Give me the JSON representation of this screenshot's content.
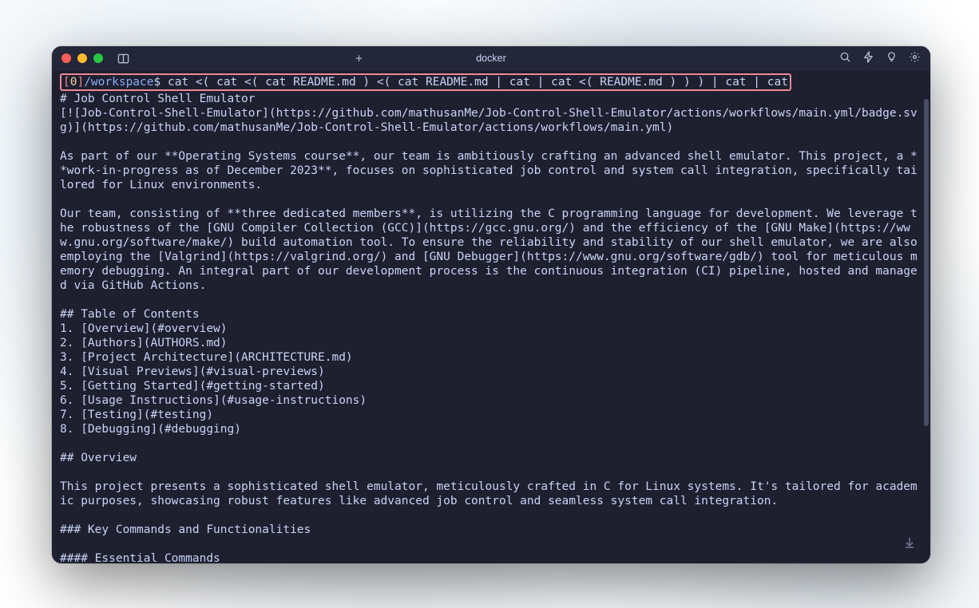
{
  "titlebar": {
    "tab_title": "docker",
    "new_tab_glyph": "+"
  },
  "prompt": {
    "open_bracket": "[",
    "job_num": "0",
    "close_bracket": "]",
    "path": "/workspace",
    "dollar": "$",
    "command": " cat <( cat <( cat README.md ) <( cat README.md | cat | cat <( README.md ) ) ) | cat | cat"
  },
  "output_lines": [
    "# Job Control Shell Emulator",
    "[![Job-Control-Shell-Emulator](https://github.com/mathusanMe/Job-Control-Shell-Emulator/actions/workflows/main.yml/badge.svg)](https://github.com/mathusanMe/Job-Control-Shell-Emulator/actions/workflows/main.yml)",
    "",
    "As part of our **Operating Systems course**, our team is ambitiously crafting an advanced shell emulator. This project, a **work-in-progress as of December 2023**, focuses on sophisticated job control and system call integration, specifically tailored for Linux environments.",
    "",
    "Our team, consisting of **three dedicated members**, is utilizing the C programming language for development. We leverage the robustness of the [GNU Compiler Collection (GCC)](https://gcc.gnu.org/) and the efficiency of the [GNU Make](https://www.gnu.org/software/make/) build automation tool. To ensure the reliability and stability of our shell emulator, we are also employing the [Valgrind](https://valgrind.org/) and [GNU Debugger](https://www.gnu.org/software/gdb/) tool for meticulous memory debugging. An integral part of our development process is the continuous integration (CI) pipeline, hosted and managed via GitHub Actions.",
    "",
    "## Table of Contents",
    "1. [Overview](#overview)",
    "2. [Authors](AUTHORS.md)",
    "3. [Project Architecture](ARCHITECTURE.md)",
    "4. [Visual Previews](#visual-previews)",
    "5. [Getting Started](#getting-started)",
    "6. [Usage Instructions](#usage-instructions)",
    "7. [Testing](#testing)",
    "8. [Debugging](#debugging)",
    "",
    "## Overview",
    "",
    "This project presents a sophisticated shell emulator, meticulously crafted in C for Linux systems. It's tailored for academic purposes, showcasing robust features like advanced job control and seamless system call integration.",
    "",
    "### Key Commands and Functionalities",
    "",
    "#### Essential Commands"
  ]
}
